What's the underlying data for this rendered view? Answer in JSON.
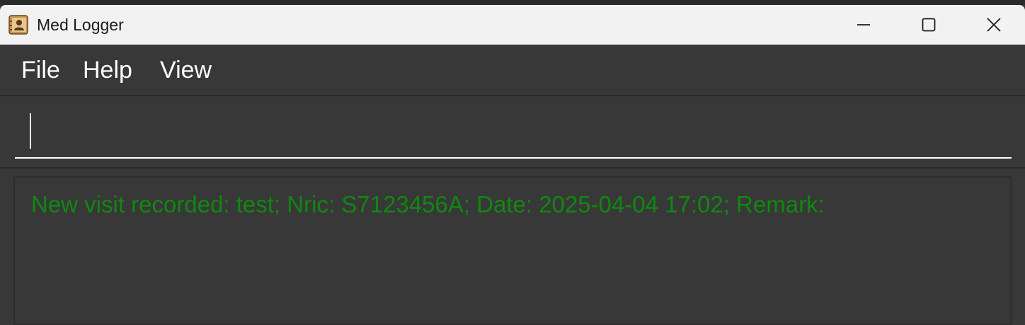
{
  "window": {
    "title": "Med Logger",
    "icon": "contact-book-icon"
  },
  "window_controls": {
    "minimize_icon": "minimize-icon",
    "maximize_icon": "maximize-icon",
    "close_icon": "close-icon"
  },
  "menu": {
    "items": [
      {
        "label": "File"
      },
      {
        "label": "Help"
      },
      {
        "label": "View"
      }
    ]
  },
  "command_box": {
    "value": "",
    "placeholder": ""
  },
  "result_display": {
    "message": "New visit recorded: test; Nric: S7123456A; Date: 2025-04-04 17:02; Remark:"
  },
  "colors": {
    "background": "#383838",
    "titlebar": "#f2f2f2",
    "result_text": "#10880f",
    "menu_text": "#ffffff"
  }
}
